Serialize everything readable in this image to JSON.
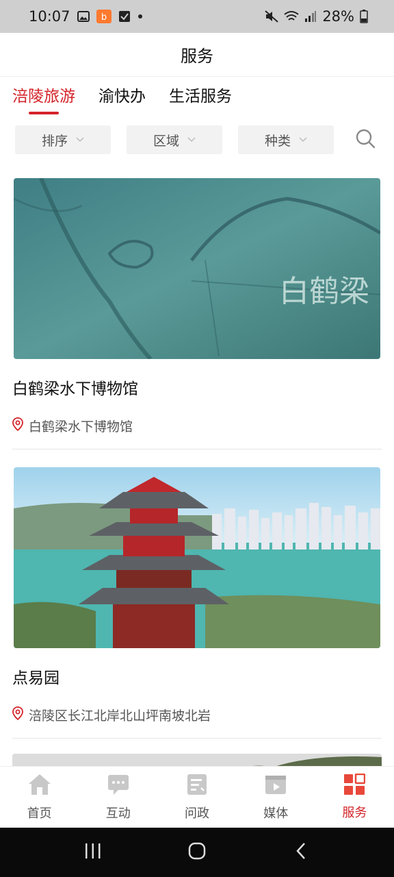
{
  "status_bar": {
    "time": "10:07",
    "battery": "28%"
  },
  "header": {
    "title": "服务"
  },
  "tabs": [
    {
      "label": "涪陵旅游",
      "active": true
    },
    {
      "label": "渝快办",
      "active": false
    },
    {
      "label": "生活服务",
      "active": false
    }
  ],
  "filters": [
    {
      "label": "排序"
    },
    {
      "label": "区域"
    },
    {
      "label": "种类"
    }
  ],
  "places": [
    {
      "title": "白鹤梁水下博物馆",
      "location": "白鹤梁水下博物馆",
      "image_text": "白鹤梁"
    },
    {
      "title": "点易园",
      "location": "涪陵区长江北岸北山坪南坡北岩"
    }
  ],
  "bottom_nav": [
    {
      "label": "首页",
      "icon": "home-icon"
    },
    {
      "label": "互动",
      "icon": "chat-icon"
    },
    {
      "label": "问政",
      "icon": "inquiry-icon"
    },
    {
      "label": "媒体",
      "icon": "media-icon"
    },
    {
      "label": "服务",
      "icon": "service-icon",
      "active": true
    }
  ],
  "colors": {
    "accent": "#d4232a",
    "status_bar": "#cfcfcf"
  }
}
